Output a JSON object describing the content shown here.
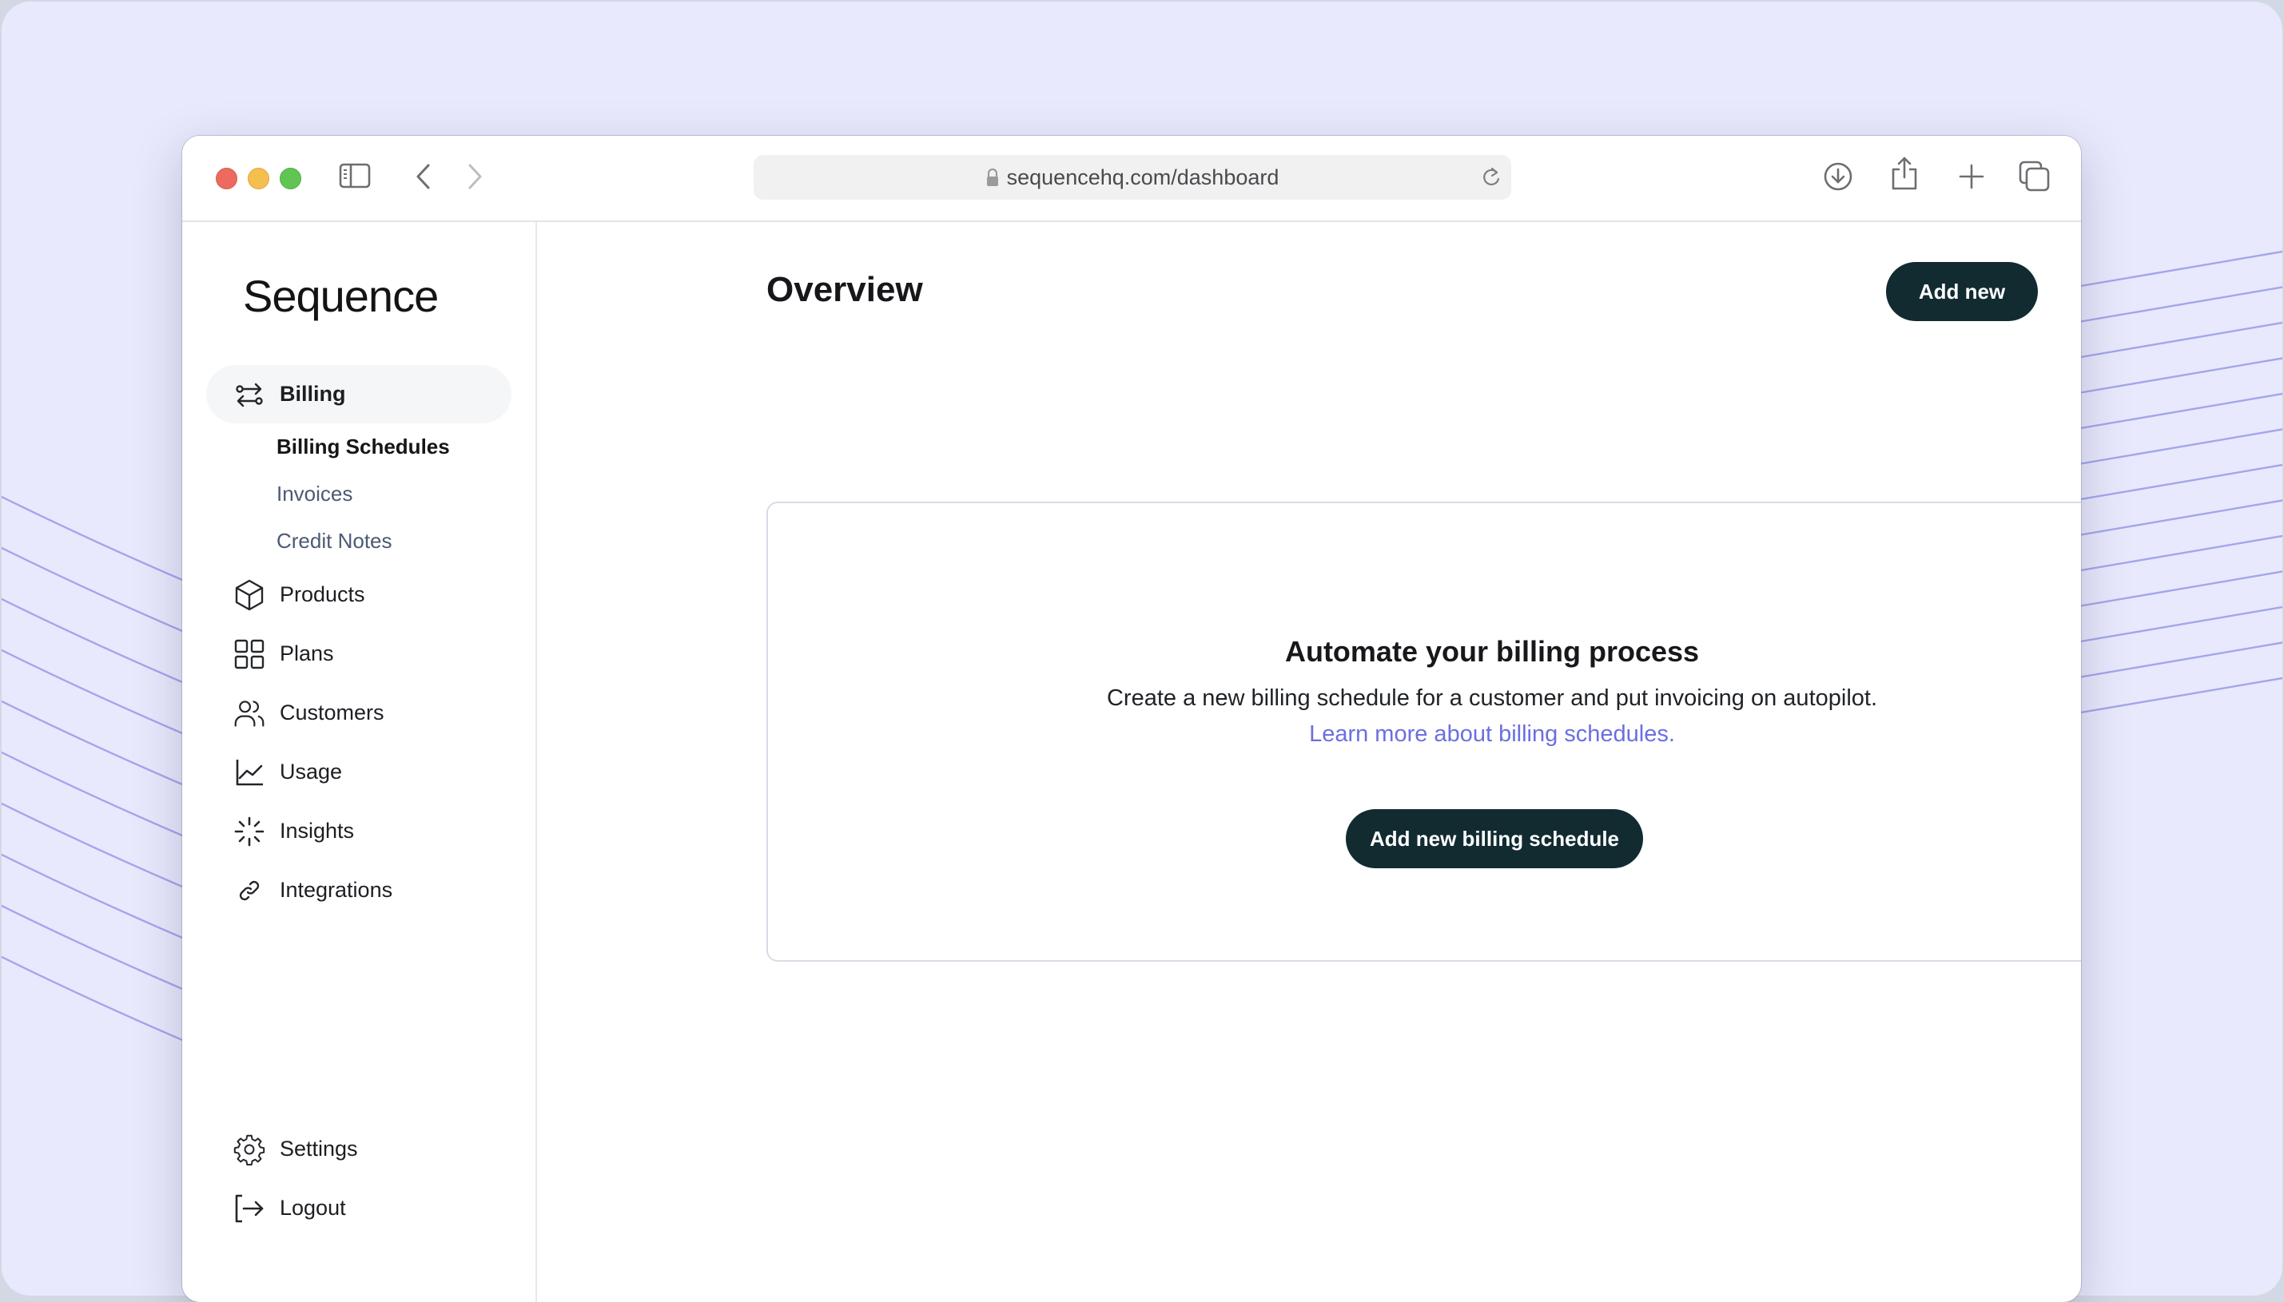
{
  "browser": {
    "url": "sequencehq.com/dashboard",
    "icons": [
      "sidebar-toggle-icon",
      "back-icon",
      "forward-icon",
      "lock-icon",
      "reload-icon",
      "download-icon",
      "share-icon",
      "new-tab-icon",
      "tab-overview-icon"
    ]
  },
  "sidebar": {
    "logo": "Sequence",
    "billing": {
      "label": "Billing",
      "icon": "arrows-exchange-icon",
      "sub_items": [
        {
          "label": "Billing Schedules",
          "active": true
        },
        {
          "label": "Invoices",
          "active": false
        },
        {
          "label": "Credit Notes",
          "active": false
        }
      ]
    },
    "items": [
      {
        "label": "Products",
        "icon": "cube-icon"
      },
      {
        "label": "Plans",
        "icon": "grid-icon"
      },
      {
        "label": "Customers",
        "icon": "users-icon"
      },
      {
        "label": "Usage",
        "icon": "chart-line-icon"
      },
      {
        "label": "Insights",
        "icon": "sparkle-icon"
      },
      {
        "label": "Integrations",
        "icon": "link-icon"
      }
    ],
    "bottom_items": [
      {
        "label": "Settings",
        "icon": "gear-icon"
      },
      {
        "label": "Logout",
        "icon": "logout-icon"
      }
    ]
  },
  "main": {
    "title": "Overview",
    "add_new_label": "Add new",
    "empty_state": {
      "title": "Automate your billing process",
      "description": "Create a new billing schedule for a customer and put invoicing on autopilot.",
      "link_text": "Learn more about billing schedules.",
      "button_label": "Add new billing schedule"
    }
  },
  "colors": {
    "primary_button": "#112B31",
    "link": "#6A6FE0",
    "background": "#E8E9FC",
    "decor_lines": "#A4A5EC"
  }
}
